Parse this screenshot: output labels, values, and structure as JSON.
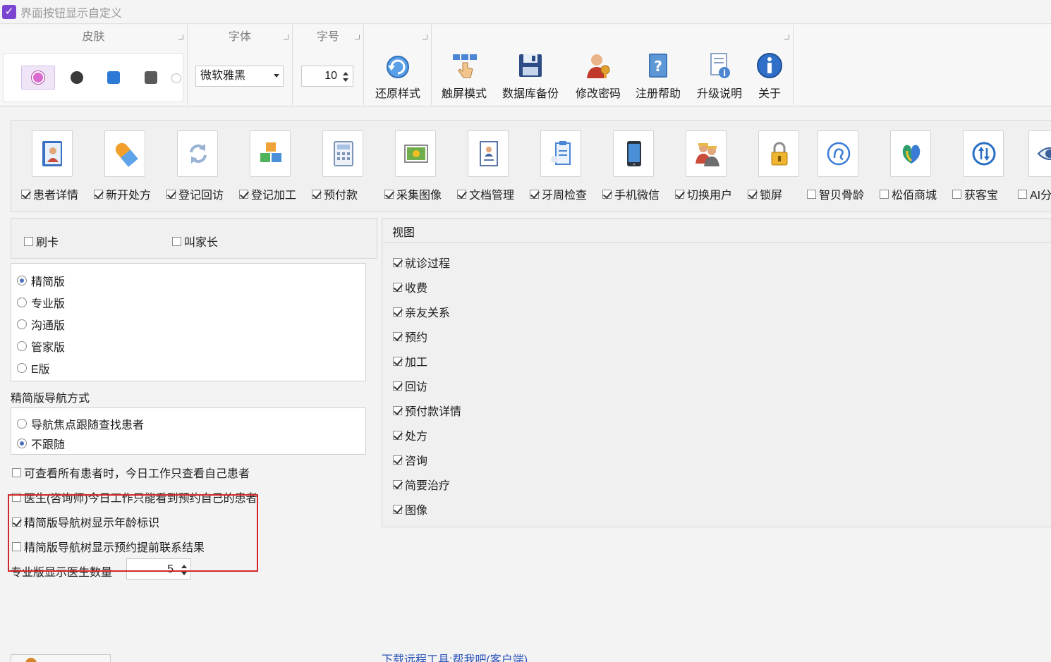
{
  "window": {
    "title": "界面按钮显示自定义"
  },
  "ribbon": {
    "skin_group": "皮肤",
    "font_group": "字体",
    "fontsize_group": "字号",
    "font_value": "微软雅黑",
    "fontsize_value": "10",
    "buttons": [
      {
        "label": "还原样式",
        "icon": "restore-icon"
      },
      {
        "label": "触屏模式",
        "icon": "touch-icon"
      },
      {
        "label": "数据库备份",
        "icon": "database-backup-icon"
      },
      {
        "label": "修改密码",
        "icon": "change-password-icon"
      },
      {
        "label": "注册帮助",
        "icon": "help-book-icon"
      },
      {
        "label": "升级说明",
        "icon": "upgrade-doc-icon"
      },
      {
        "label": "关于",
        "icon": "info-icon"
      }
    ]
  },
  "modules": [
    {
      "label": "患者详情",
      "checked": true,
      "icon": "patient-card-icon"
    },
    {
      "label": "新开处方",
      "checked": true,
      "icon": "pill-icon"
    },
    {
      "label": "登记回访",
      "checked": true,
      "icon": "refresh-icon"
    },
    {
      "label": "登记加工",
      "checked": true,
      "icon": "cubes-icon"
    },
    {
      "label": "预付款",
      "checked": true,
      "icon": "calculator-icon"
    },
    {
      "label": "采集图像",
      "checked": true,
      "icon": "photo-icon"
    },
    {
      "label": "文档管理",
      "checked": true,
      "icon": "document-icon"
    },
    {
      "label": "牙周检查",
      "checked": true,
      "icon": "clipboard-icon"
    },
    {
      "label": "手机微信",
      "checked": true,
      "icon": "phone-icon"
    },
    {
      "label": "切换用户",
      "checked": true,
      "icon": "switch-user-icon"
    },
    {
      "label": "锁屏",
      "checked": true,
      "icon": "lock-icon"
    },
    {
      "label": "智贝骨龄",
      "checked": false,
      "icon": "bone-age-icon"
    },
    {
      "label": "松佰商城",
      "checked": false,
      "icon": "mall-icon"
    },
    {
      "label": "获客宝",
      "checked": false,
      "icon": "sync-arrows-icon"
    },
    {
      "label": "AI分",
      "checked": false,
      "icon": "eye-icon"
    }
  ],
  "card_options": [
    {
      "label": "刷卡",
      "checked": false
    },
    {
      "label": "叫家长",
      "checked": false
    }
  ],
  "editions": [
    {
      "label": "精简版",
      "selected": true
    },
    {
      "label": "专业版",
      "selected": false
    },
    {
      "label": "沟通版",
      "selected": false
    },
    {
      "label": "管家版",
      "selected": false
    },
    {
      "label": "E版",
      "selected": false
    }
  ],
  "nav_section_label": "精简版导航方式",
  "nav_modes": [
    {
      "label": "导航焦点跟随查找患者",
      "selected": false
    },
    {
      "label": "不跟随",
      "selected": true
    }
  ],
  "options": [
    {
      "label": "可查看所有患者时，今日工作只查看自己患者",
      "checked": false
    },
    {
      "label": "医生(咨询师)今日工作只能看到预约自己的患者",
      "checked": false
    },
    {
      "label": "精简版导航树显示年龄标识",
      "checked": true
    },
    {
      "label": "精简版导航树显示预约提前联系结果",
      "checked": false
    }
  ],
  "doctor_count_label": "专业版显示医生数量",
  "doctor_count_value": "5",
  "view": {
    "title": "视图",
    "items": [
      {
        "label": "就诊过程",
        "checked": true
      },
      {
        "label": "收费",
        "checked": true
      },
      {
        "label": "亲友关系",
        "checked": true
      },
      {
        "label": "预约",
        "checked": true
      },
      {
        "label": "加工",
        "checked": true
      },
      {
        "label": "回访",
        "checked": true
      },
      {
        "label": "预付款详情",
        "checked": true
      },
      {
        "label": "处方",
        "checked": true
      },
      {
        "label": "咨询",
        "checked": true
      },
      {
        "label": "简要治疗",
        "checked": true
      },
      {
        "label": "图像",
        "checked": true
      }
    ]
  },
  "remote_link": "下载远程工具:帮我吧(客户端)",
  "colors": {
    "accent": "#7b44d1",
    "highlight_border": "#d0282a",
    "link": "#2a52b8"
  }
}
